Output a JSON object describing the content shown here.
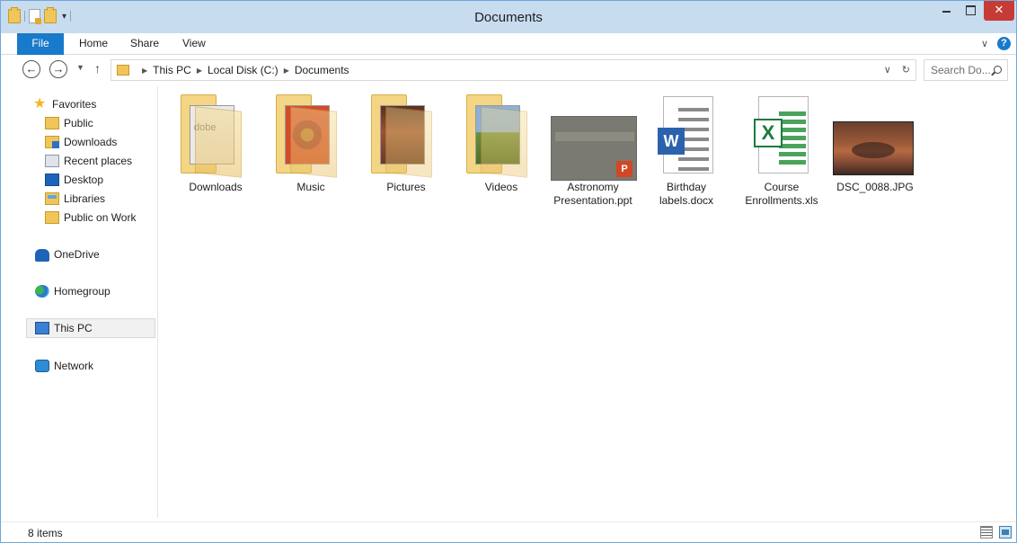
{
  "window": {
    "title": "Documents",
    "close_label": "✕"
  },
  "ribbon": {
    "tabs": [
      "File",
      "Home",
      "Share",
      "View"
    ],
    "help_label": "?"
  },
  "address": {
    "crumbs": [
      "This PC",
      "Local Disk (C:)",
      "Documents"
    ],
    "search_placeholder": "Search Do..."
  },
  "sidebar": {
    "favorites_label": "Favorites",
    "favorites": [
      "Public",
      "Downloads",
      "Recent places",
      "Desktop",
      "Libraries",
      "Public on Work"
    ],
    "onedrive_label": "OneDrive",
    "homegroup_label": "Homegroup",
    "thispc_label": "This PC",
    "network_label": "Network"
  },
  "items": [
    {
      "name": "Downloads",
      "type": "folder"
    },
    {
      "name": "Music",
      "type": "folder"
    },
    {
      "name": "Pictures",
      "type": "folder"
    },
    {
      "name": "Videos",
      "type": "folder"
    },
    {
      "name": "Astronomy Presentation.ppt",
      "type": "ppt"
    },
    {
      "name": "Birthday labels.docx",
      "type": "word"
    },
    {
      "name": "Course Enrollments.xls",
      "type": "excel"
    },
    {
      "name": "DSC_0088.JPG",
      "type": "image"
    }
  ],
  "folder_thumbs": {
    "downloads_text": "dobe"
  },
  "icons": {
    "word_letter": "W",
    "excel_letter": "X",
    "ppt_letter": "P"
  },
  "status": {
    "count": "8 items"
  },
  "colors": {
    "titlebar": "#c8dcf0",
    "file_tab": "#1979ca",
    "close_button": "#c73b36",
    "folder": "#f0c65a"
  }
}
